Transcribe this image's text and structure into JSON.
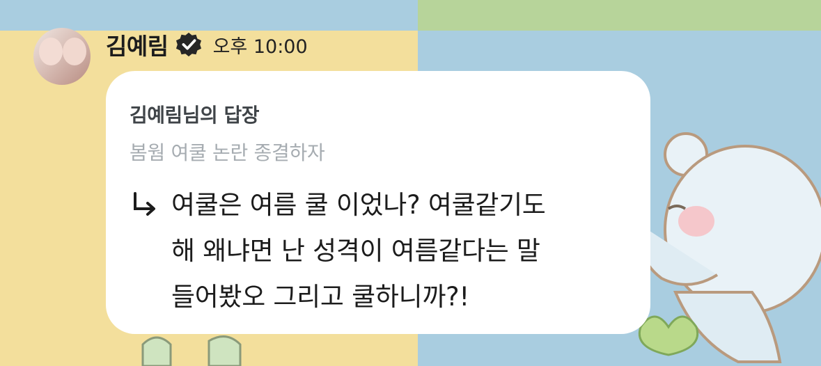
{
  "message": {
    "sender_name": "김예림",
    "timestamp": "오후 10:00",
    "avatar_icon": "profile-photo",
    "verified_icon": "verified-badge-icon",
    "reply": {
      "title": "김예림님의 답장",
      "quoted_text": "봄웜 여쿨 논란 종결하자"
    },
    "body_lines": [
      "여쿨은 여름 쿨 이었나? 여쿨같기도",
      "해 왜냐면 난 성격이 여름같다는 말",
      "들어봤오 그리고 쿨하니까?!"
    ]
  },
  "colors": {
    "bubble": "#ffffff",
    "background_yellow": "#f3df9c",
    "background_blue": "#a9cde0",
    "background_green": "#b7d49a",
    "quote_text": "#a6acb1",
    "primary_text": "#1c1c1c"
  }
}
